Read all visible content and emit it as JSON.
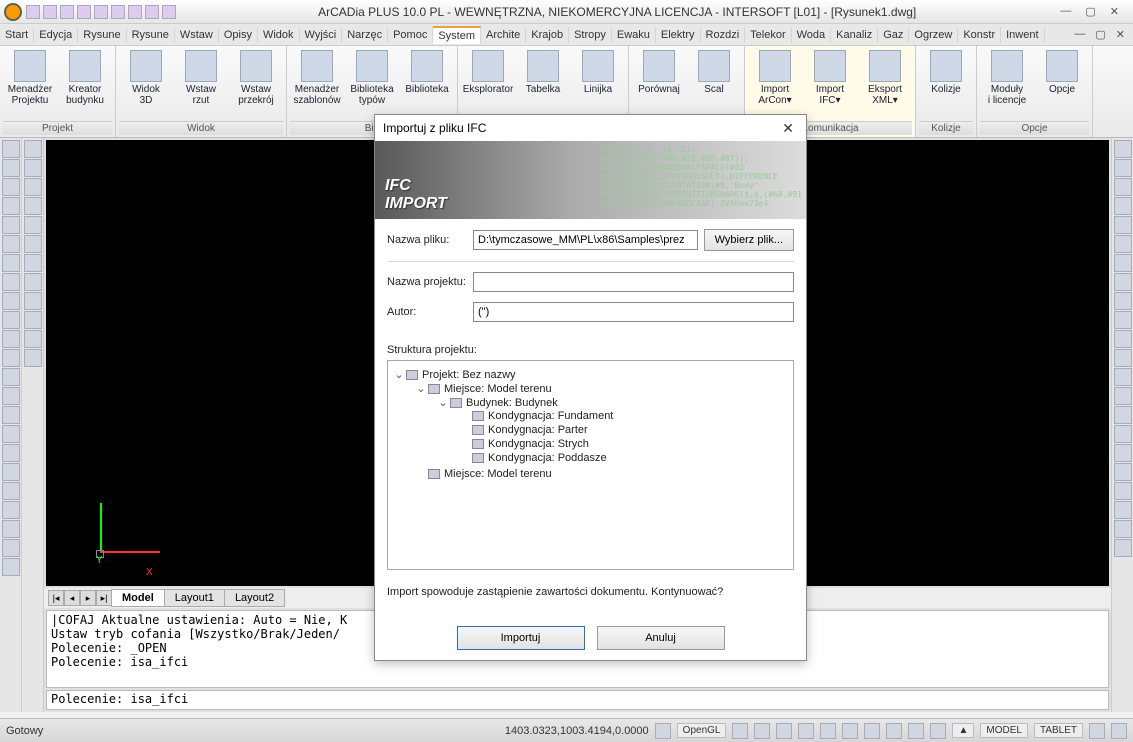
{
  "title": "ArCADia PLUS 10.0 PL - WEWNĘTRZNA, NIEKOMERCYJNA LICENCJA - INTERSOFT [L01] - [Rysunek1.dwg]",
  "menu": [
    "Start",
    "Edycja",
    "Rysune",
    "Rysune",
    "Wstaw",
    "Opisy",
    "Widok",
    "Wyjści",
    "Narzęc",
    "Pomoc",
    "System",
    "Archite",
    "Krajob",
    "Stropy",
    "Ewaku",
    "Elektry",
    "Rozdzi",
    "Telekor",
    "Woda",
    "Kanaliz",
    "Gaz",
    "Ogrzew",
    "Konstr",
    "Inwent"
  ],
  "menu_active_index": 10,
  "ribbon": {
    "panels": [
      {
        "label": "Projekt",
        "items": [
          {
            "t": "Menadżer\nProjektu"
          },
          {
            "t": "Kreator\nbudynku"
          }
        ]
      },
      {
        "label": "Widok",
        "items": [
          {
            "t": "Widok\n3D"
          },
          {
            "t": "Wstaw\nrzut"
          },
          {
            "t": "Wstaw\nprzekrój"
          }
        ]
      },
      {
        "label": "Bib",
        "items": [
          {
            "t": "Menadżer\nszablonów"
          },
          {
            "t": "Biblioteka\ntypów"
          },
          {
            "t": "Biblioteka"
          }
        ]
      },
      {
        "label": "",
        "items": [
          {
            "t": "Eksplorator"
          },
          {
            "t": "Tabelka"
          },
          {
            "t": "Linijka"
          }
        ]
      },
      {
        "label": "",
        "items": [
          {
            "t": "Porównaj"
          },
          {
            "t": "Scal"
          }
        ]
      },
      {
        "label": "Komunikacja",
        "active": true,
        "items": [
          {
            "t": "Import\nArCon▾"
          },
          {
            "t": "Import\nIFC▾"
          },
          {
            "t": "Eksport\nXML▾"
          }
        ]
      },
      {
        "label": "Kolizje",
        "items": [
          {
            "t": "Kolizje"
          }
        ]
      },
      {
        "label": "Opcje",
        "items": [
          {
            "t": "Moduły\ni licencje"
          },
          {
            "t": "Opcje"
          }
        ]
      }
    ]
  },
  "tabs": {
    "items": [
      "Model",
      "Layout1",
      "Layout2"
    ],
    "active": 0
  },
  "cmd_history": "|COFAJ Aktualne ustawienia: Auto = Nie, K\nUstaw tryb cofania [Wszystko/Brak/Jeden/\nPolecenie: _OPEN\nPolecenie: isa_ifci",
  "cmd_line": "Polecenie: isa_ifci",
  "status": {
    "ready": "Gotowy",
    "coords": "1403.0323,1003.4194,0.0000",
    "toggles": [
      "OpenGL",
      "▲",
      "MODEL",
      "TABLET"
    ]
  },
  "dialog": {
    "title": "Importuj z pliku IFC",
    "banner": "IFC\nIMPORT",
    "code": "#ANPOINT((0.,18.25));\n#FCPOLYLINE((#84,#85,#86,#87));\n#POLYGONALBOUNDEDHALFSPACE(#82\n#IFCBOOLEANCLIPPINGRESULT(.DIFFERENCE\n#IFCSHAPEREPRESENTATION(#9,'Body'\n#92=IFCPRODUCTDEFINITIONSHAPE($,$,(#68,#91\n#93=IFCWALLSTANDARDCASE('2VAhov73e4",
    "fields": {
      "file_label": "Nazwa pliku:",
      "file_value": "D:\\tymczasowe_MM\\PL\\x86\\Samples\\prez",
      "browse": "Wybierz plik...",
      "proj_label": "Nazwa projektu:",
      "proj_value": "",
      "author_label": "Autor:",
      "author_value": "(\")"
    },
    "tree_label": "Struktura projektu:",
    "tree": {
      "root": "Projekt: Bez nazwy",
      "site1": "Miejsce: Model terenu",
      "building": "Budynek: Budynek",
      "levels": [
        "Kondygnacja: Fundament",
        "Kondygnacja: Parter",
        "Kondygnacja: Strych",
        "Kondygnacja: Poddasze"
      ],
      "site2": "Miejsce: Model terenu"
    },
    "note": "Import spowoduje zastąpienie zawartości dokumentu. Kontynuować?",
    "ok": "Importuj",
    "cancel": "Anuluj"
  }
}
